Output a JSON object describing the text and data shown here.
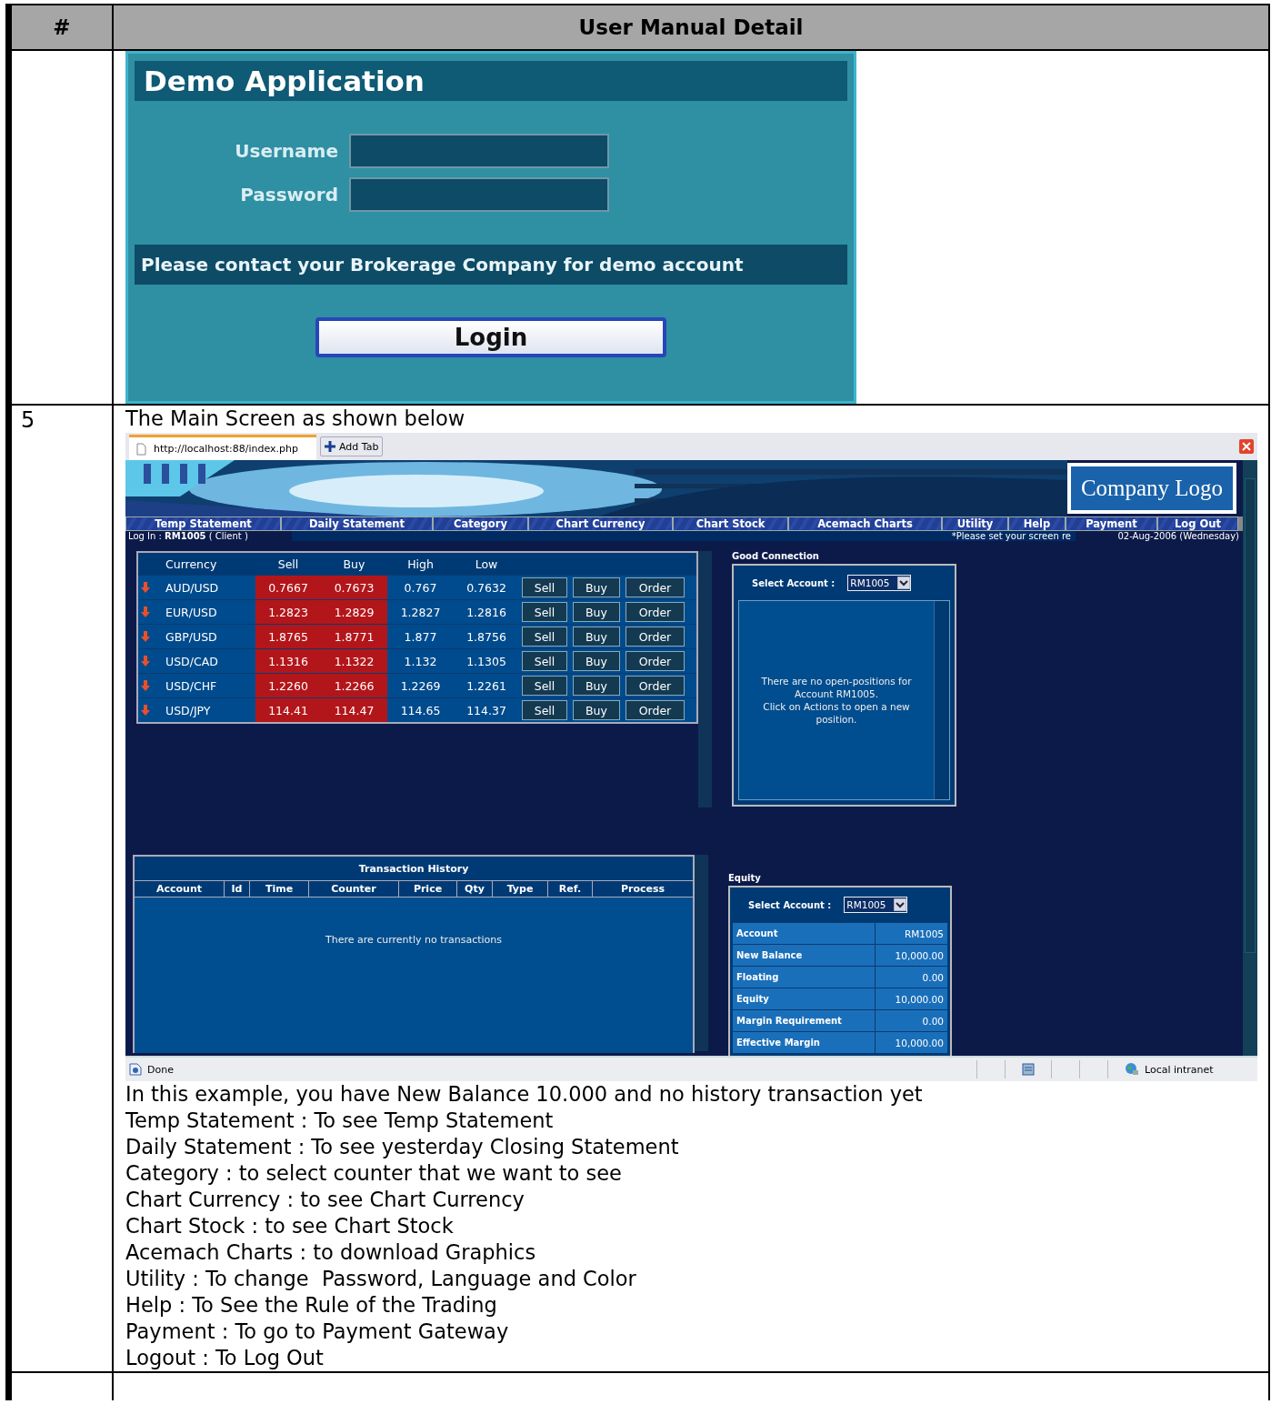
{
  "manual_table": {
    "columns": [
      "#",
      "User Manual Detail"
    ],
    "rows": [
      {
        "login_screen": {
          "title": "Demo Application",
          "fields": [
            {
              "label": "Username"
            },
            {
              "label": "Password"
            }
          ],
          "notice": "Please contact your Brokerage Company for demo account",
          "button": "Login"
        }
      },
      {
        "number": "5",
        "heading": "The Main Screen as shown below",
        "browser": {
          "tabs": [
            {
              "label": "http://localhost:88/index.php",
              "selected": true
            }
          ],
          "add_tab": "Add Tab",
          "app": {
            "logo": "Company Logo",
            "nav": [
              "Temp Statement",
              "Daily Statement",
              "Category",
              "Chart Currency",
              "Chart Stock",
              "Acemach Charts",
              "Utility",
              "Help",
              "Payment",
              "Log Out"
            ],
            "login_info": "Log In : **RM1005** ( Client )",
            "screen_notice": "*Please set your screen re",
            "date": "02-Aug-2006 (Wednesday)",
            "rates": {
              "columns": [
                "Currency",
                "Sell",
                "Buy",
                "High",
                "Low"
              ],
              "rows": [
                {
                  "falling": true,
                  "pair": "AUD/USD",
                  "sell": "0.7667",
                  "buy": "0.7673",
                  "high": "0.767",
                  "low": "0.7632",
                  "actions": [
                    "Sell",
                    "Buy",
                    "Order"
                  ]
                },
                {
                  "falling": true,
                  "pair": "EUR/USD",
                  "sell": "1.2823",
                  "buy": "1.2829",
                  "high": "1.2827",
                  "low": "1.2816",
                  "actions": [
                    "Sell",
                    "Buy",
                    "Order"
                  ]
                },
                {
                  "falling": true,
                  "pair": "GBP/USD",
                  "sell": "1.8765",
                  "buy": "1.8771",
                  "high": "1.877",
                  "low": "1.8756",
                  "actions": [
                    "Sell",
                    "Buy",
                    "Order"
                  ]
                },
                {
                  "falling": true,
                  "pair": "USD/CAD",
                  "sell": "1.1316",
                  "buy": "1.1322",
                  "high": "1.132",
                  "low": "1.1305",
                  "actions": [
                    "Sell",
                    "Buy",
                    "Order"
                  ]
                },
                {
                  "falling": true,
                  "pair": "USD/CHF",
                  "sell": "1.2260",
                  "buy": "1.2266",
                  "high": "1.2269",
                  "low": "1.2261",
                  "actions": [
                    "Sell",
                    "Buy",
                    "Order"
                  ]
                },
                {
                  "falling": true,
                  "pair": "USD/JPY",
                  "sell": "114.41",
                  "buy": "114.47",
                  "high": "114.65",
                  "low": "114.37",
                  "actions": [
                    "Sell",
                    "Buy",
                    "Order"
                  ]
                }
              ]
            },
            "positions": {
              "title": "Good Connection",
              "select_label": "Select Account :",
              "account": "RM1005",
              "message": [
                "There are no open-positions for Account RM1005.",
                "Click on Actions to open a new position."
              ]
            },
            "transactions": {
              "title": "Transaction History",
              "columns": [
                "Account",
                "Id",
                "Time",
                "Counter",
                "Price",
                "Qty",
                "Type",
                "Ref.",
                "Process"
              ],
              "empty": "There are currently no transactions"
            },
            "equity": {
              "title": "Equity",
              "select_label": "Select Account :",
              "account": "RM1005",
              "rows": [
                {
                  "label": "Account",
                  "value": "RM1005"
                },
                {
                  "label": "New Balance",
                  "value": "10,000.00"
                },
                {
                  "label": "Floating",
                  "value": "0.00"
                },
                {
                  "label": "Equity",
                  "value": "10,000.00"
                },
                {
                  "label": "Margin Requirement",
                  "value": "0.00"
                },
                {
                  "label": "Effective Margin",
                  "value": "10,000.00"
                }
              ]
            }
          },
          "status_bar": {
            "text": "Done",
            "zone": "Local intranet"
          }
        },
        "notes": [
          "In this example, you have New Balance 10.000 and no history transaction yet",
          "Temp Statement : To see Temp Statement",
          "Daily Statement : To see yesterday Closing Statement",
          "Category : to select counter that we want to see",
          "Chart Currency : to see Chart Currency",
          "Chart Stock : to see Chart Stock",
          "Acemach Charts : to download Graphics",
          "Utility : To change  Password, Language and Color",
          "Help : To See the Rule of the Trading",
          "Payment : To go to Payment Gateway",
          "Logout : To Log Out"
        ]
      },
      {}
    ]
  }
}
